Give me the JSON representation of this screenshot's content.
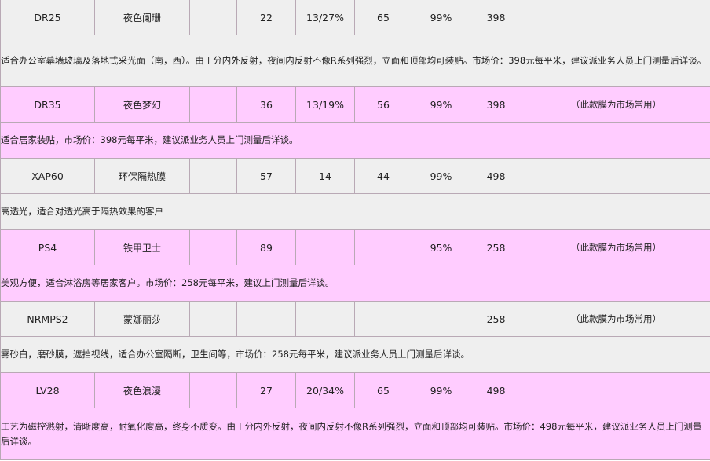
{
  "rows": [
    {
      "model": "DR25",
      "name": "夜色阑珊",
      "c3": "",
      "c4": "22",
      "c5": "13/27%",
      "c6": "65",
      "c7": "99%",
      "price": "398",
      "note": "",
      "description": "适合办公室幕墙玻璃及落地式采光面（南，西）。由于分内外反射，夜间内反射不像R系列强烈，立面和顶部均可装贴。市场价：398元每平米，建议派业务人员上门测量后详谈。"
    },
    {
      "model": "DR35",
      "name": "夜色梦幻",
      "c3": "",
      "c4": "36",
      "c5": "13/19%",
      "c6": "56",
      "c7": "99%",
      "price": "398",
      "note": "（此款膜为市场常用）",
      "description": "适合居家装贴，市场价：398元每平米，建议派业务人员上门测量后详谈。"
    },
    {
      "model": "XAP60",
      "name": "环保隔热膜",
      "c3": "",
      "c4": "57",
      "c5": "14",
      "c6": "44",
      "c7": "99%",
      "price": "498",
      "note": "",
      "description": "高透光，适合对透光高于隔热效果的客户"
    },
    {
      "model": "PS4",
      "name": "铁甲卫士",
      "c3": "",
      "c4": "89",
      "c5": "",
      "c6": "",
      "c7": "95%",
      "price": "258",
      "note": "（此款膜为市场常用）",
      "description": "美观方便，适合淋浴房等居家客户。市场价：258元每平米，建议上门测量后详谈。"
    },
    {
      "model": "NRMPS2",
      "name": "蒙娜丽莎",
      "c3": "",
      "c4": "",
      "c5": "",
      "c6": "",
      "c7": "",
      "price": "258",
      "note": "（此款膜为市场常用）",
      "description": "雾砂白，磨砂膜，遮挡视线，适合办公室隔断，卫生间等，市场价：258元每平米，建议派业务人员上门测量后详谈。"
    },
    {
      "model": "LV28",
      "name": "夜色浪漫",
      "c3": "",
      "c4": "27",
      "c5": "20/34%",
      "c6": "65",
      "c7": "99%",
      "price": "498",
      "note": "",
      "description": "工艺为磁控溅射，清晰度高，耐氧化度高，终身不质变。由于分内外反射，夜间内反射不像R系列强烈，立面和顶部均可装贴。市场价：498元每平米，建议派业务人员上门测量后详谈。"
    }
  ],
  "row_colors": {
    "grey": "#efefef",
    "pink": "#ffccff",
    "border": "#b9a9b5"
  }
}
